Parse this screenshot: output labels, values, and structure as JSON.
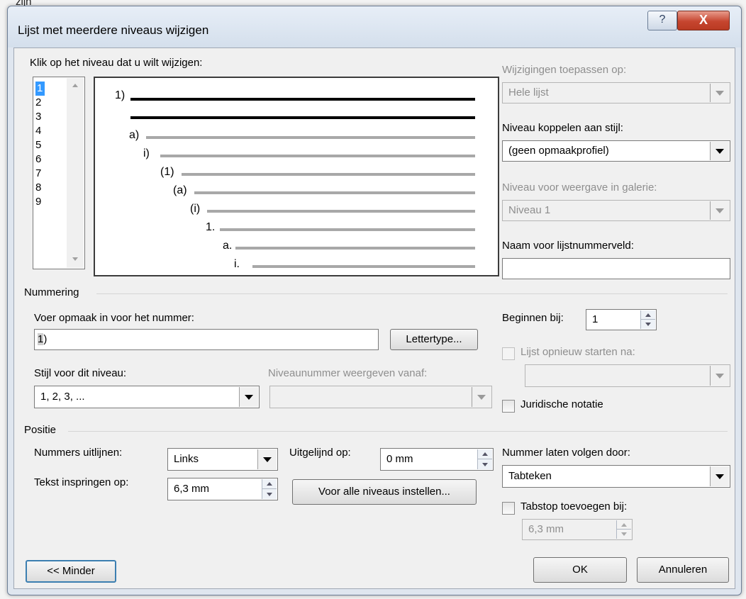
{
  "background_text": "zijn",
  "window": {
    "title": "Lijst met meerdere niveaus wijzigen",
    "help_icon": "?",
    "close_icon": "X"
  },
  "level_select": {
    "label": "Klik op het niveau dat u wilt wijzigen:",
    "levels": [
      "1",
      "2",
      "3",
      "4",
      "5",
      "6",
      "7",
      "8",
      "9"
    ],
    "selected": "1"
  },
  "preview": {
    "numbers": [
      "1)",
      "a)",
      "i)",
      "(1)",
      "(a)",
      "(i)",
      "1.",
      "a.",
      "i."
    ]
  },
  "right_panel": {
    "apply_to_label": "Wijzigingen toepassen op:",
    "apply_to_value": "Hele lijst",
    "link_style_label": "Niveau koppelen aan stijl:",
    "link_style_value": "(geen opmaakprofiel)",
    "gallery_level_label": "Niveau voor weergave in galerie:",
    "gallery_level_value": "Niveau 1",
    "field_name_label": "Naam voor lijstnummerveld:",
    "field_name_value": ""
  },
  "numbering": {
    "section_label": "Nummering",
    "format_label": "Voer opmaak in voor het nummer:",
    "format_value_hl": "1",
    "format_value_rest": ")",
    "font_button": "Lettertype...",
    "style_label": "Stijl voor dit niveau:",
    "style_value": "1, 2, 3, ...",
    "include_level_label": "Niveaunummer weergeven vanaf:",
    "include_level_value": "",
    "start_at_label": "Beginnen bij:",
    "start_at_value": "1",
    "restart_label": "Lijst opnieuw starten na:",
    "restart_value": "",
    "legal_label": "Juridische notatie"
  },
  "position": {
    "section_label": "Positie",
    "align_label": "Nummers uitlijnen:",
    "align_value": "Links",
    "aligned_at_label": "Uitgelijnd op:",
    "aligned_at_value": "0 mm",
    "indent_label": "Tekst inspringen op:",
    "indent_value": "6,3 mm",
    "set_all_button": "Voor alle niveaus instellen...",
    "follow_label": "Nummer laten volgen door:",
    "follow_value": "Tabteken",
    "tabstop_label": "Tabstop toevoegen bij:",
    "tabstop_value": "6,3 mm"
  },
  "footer": {
    "less_button": "<< Minder",
    "ok_button": "OK",
    "cancel_button": "Annuleren"
  },
  "colors": {
    "selection": "#3399ff",
    "close_button": "#c6452f",
    "dialog_bg": "#f0f0f0"
  }
}
